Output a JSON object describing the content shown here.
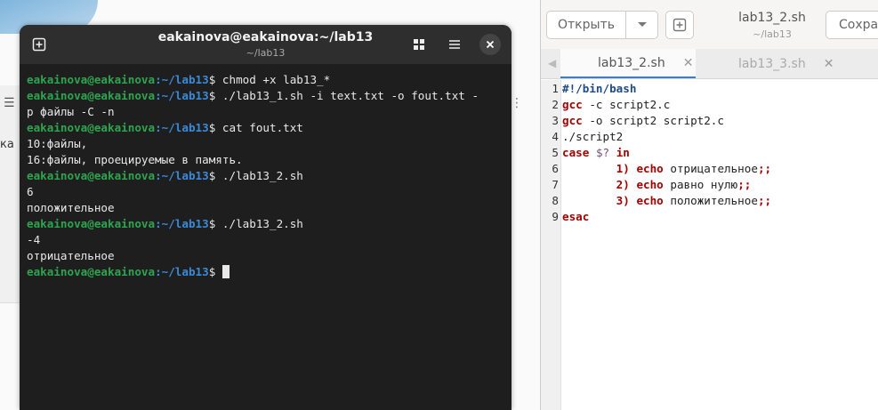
{
  "background": {
    "left_text": "ка",
    "menu_icon": "hamburger-icon",
    "dots_icon": "kebab-icon"
  },
  "terminal": {
    "title": "eakainova@eakainova:~/lab13",
    "subtitle": "~/lab13",
    "buttons": [
      "new-tab-icon",
      "grid-icon",
      "menu-icon",
      "close-icon"
    ],
    "prompt_user": "eakainova@eakainova",
    "prompt_path": ":~/lab13",
    "prompt_symbol": "$ ",
    "lines": [
      {
        "type": "cmd",
        "text": "chmod +x lab13_*"
      },
      {
        "type": "cmd",
        "text": "./lab13_1.sh -i text.txt -o fout.txt -"
      },
      {
        "type": "out",
        "text": "р файлы -C -n"
      },
      {
        "type": "cmd",
        "text": "cat fout.txt"
      },
      {
        "type": "out",
        "text": "10:файлы,"
      },
      {
        "type": "out",
        "text": "16:файлы, проецируемые в память."
      },
      {
        "type": "cmd",
        "text": "./lab13_2.sh"
      },
      {
        "type": "out",
        "text": "6"
      },
      {
        "type": "out",
        "text": "положительное"
      },
      {
        "type": "cmd",
        "text": "./lab13_2.sh"
      },
      {
        "type": "out",
        "text": "-4"
      },
      {
        "type": "out",
        "text": "отрицательное"
      },
      {
        "type": "cmd",
        "text": ""
      }
    ]
  },
  "editor": {
    "open_label": "Открыть",
    "title": "lab13_2.sh",
    "subtitle": "~/lab13",
    "save_label": "Сохран",
    "tabs": [
      {
        "label": "lab13_2.sh",
        "active": true
      },
      {
        "label": "lab13_3.sh",
        "active": false
      }
    ],
    "code": [
      "#!/bin/bash",
      "gcc -c script2.c",
      "gcc -o script2 script2.c",
      "./script2",
      "case $? in",
      "        1) echo отрицательное;;",
      "        2) echo равно нулю;;",
      "        3) echo положительное;;",
      "esac"
    ]
  }
}
